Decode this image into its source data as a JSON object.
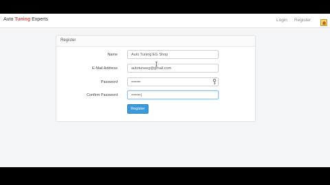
{
  "navbar": {
    "brand_prefix": "Auto ",
    "brand_accent": "Tuning",
    "brand_suffix": " Experts",
    "login": "Login",
    "register": "Register"
  },
  "card": {
    "header": "Register"
  },
  "form": {
    "name_label": "Name",
    "name_value": "Auto Tuning EG Shop",
    "email_label": "E-Mail Address",
    "email_value": "autotuneeg@gmail.com",
    "password_label": "Password",
    "password_value": "•••••••",
    "confirm_label": "Confirm Password",
    "confirm_value": "•••••••|",
    "submit": "Register"
  },
  "colors": {
    "accent": "#d9534f",
    "button": "#3a99d8"
  }
}
